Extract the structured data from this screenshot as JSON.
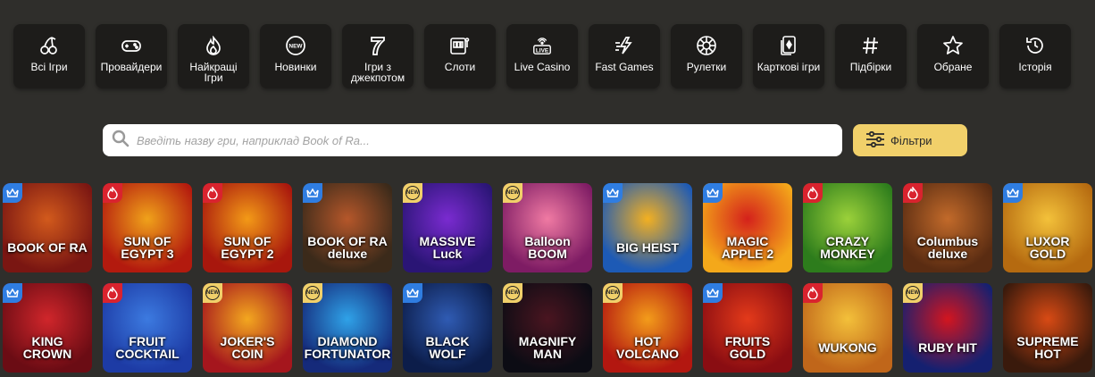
{
  "categories": [
    {
      "label": "Всі Ігри",
      "icon": "cherries-icon"
    },
    {
      "label": "Провайдери",
      "icon": "gamepad-icon"
    },
    {
      "label": "Найкращі Ігри",
      "icon": "flame-icon"
    },
    {
      "label": "Новинки",
      "icon": "new-badge-icon"
    },
    {
      "label": "Ігри з\nджекпотом",
      "icon": "seven-icon"
    },
    {
      "label": "Слоти",
      "icon": "slot-machine-icon"
    },
    {
      "label": "Live Casino",
      "icon": "live-icon"
    },
    {
      "label": "Fast Games",
      "icon": "lightning-icon"
    },
    {
      "label": "Рулетки",
      "icon": "roulette-icon"
    },
    {
      "label": "Карткові ігри",
      "icon": "cards-icon"
    },
    {
      "label": "Підбірки",
      "icon": "hash-icon"
    },
    {
      "label": "Обране",
      "icon": "star-icon"
    },
    {
      "label": "Історія",
      "icon": "history-icon"
    }
  ],
  "search": {
    "placeholder": "Введіть назву гри, наприклад Book of Ra..."
  },
  "filters": {
    "label": "Фільтри"
  },
  "games": [
    {
      "title": "BOOK OF RA",
      "badge": "crown",
      "bg": "#7a1612",
      "bg2": "#d25a1c"
    },
    {
      "title": "SUN OF EGYPT 3",
      "badge": "hot",
      "bg": "#b31a0e",
      "bg2": "#f0a21a"
    },
    {
      "title": "SUN OF EGYPT 2",
      "badge": "hot",
      "bg": "#a8170d",
      "bg2": "#f39a17"
    },
    {
      "title": "BOOK OF RA deluxe",
      "badge": "crown",
      "bg": "#3b2a1a",
      "bg2": "#b5572a"
    },
    {
      "title": "MASSIVE Luck",
      "badge": "new",
      "bg": "#2a1575",
      "bg2": "#7a2bd0"
    },
    {
      "title": "Balloon BOOM",
      "badge": "new",
      "bg": "#7e1c64",
      "bg2": "#f07aa3"
    },
    {
      "title": "BIG HEIST",
      "badge": "crown",
      "bg": "#1d5ab5",
      "bg2": "#f3b021"
    },
    {
      "title": "MAGIC APPLE 2",
      "badge": "crown",
      "bg": "#f4a81a",
      "bg2": "#d4211b"
    },
    {
      "title": "CRAZY MONKEY",
      "badge": "hot",
      "bg": "#2d7c1c",
      "bg2": "#9bd13a"
    },
    {
      "title": "Columbus deluxe",
      "badge": "hot",
      "bg": "#5a2c12",
      "bg2": "#c26a2a"
    },
    {
      "title": "LUXOR GOLD",
      "badge": "crown",
      "bg": "#b56a10",
      "bg2": "#f3c13a"
    },
    {
      "title": "KING CROWN",
      "badge": "crown",
      "bg": "#6b0c14",
      "bg2": "#d0262b"
    },
    {
      "title": "FRUIT COCKTAIL",
      "badge": "hot",
      "bg": "#1d3ba5",
      "bg2": "#3c7ae0"
    },
    {
      "title": "JOKER'S COIN",
      "badge": "new",
      "bg": "#a5161d",
      "bg2": "#f3a71f"
    },
    {
      "title": "DIAMOND FORTUNATOR",
      "badge": "new",
      "bg": "#152a7a",
      "bg2": "#2fa2e8"
    },
    {
      "title": "BLACK WOLF",
      "badge": "crown",
      "bg": "#0c1d4a",
      "bg2": "#2f5bb3"
    },
    {
      "title": "MAGNIFY MAN",
      "badge": "new",
      "bg": "#0c0c14",
      "bg2": "#4a1520"
    },
    {
      "title": "HOT VOLCANO",
      "badge": "new",
      "bg": "#b31710",
      "bg2": "#f39c1a"
    },
    {
      "title": "FRUITS GOLD",
      "badge": "crown",
      "bg": "#8a0d12",
      "bg2": "#e33a1a"
    },
    {
      "title": "WUKONG",
      "badge": "hot",
      "bg": "#c0661a",
      "bg2": "#f3c03a"
    },
    {
      "title": "RUBY HIT",
      "badge": "new",
      "bg": "#152070",
      "bg2": "#d3151f"
    },
    {
      "title": "SUPREME HOT",
      "badge": "none",
      "bg": "#3a1a0c",
      "bg2": "#d84a14"
    }
  ],
  "colors": {
    "background": "#2f2e2b",
    "tile": "#1d1c1a",
    "accent": "#f1d06a",
    "crown_badge": "#2f7de1",
    "hot_badge": "#d9232e"
  }
}
